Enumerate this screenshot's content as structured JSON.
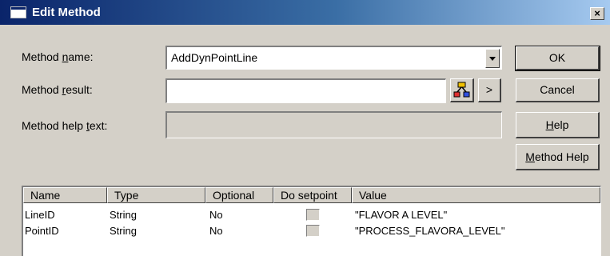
{
  "window": {
    "title": "Edit Method",
    "close_label": "×"
  },
  "form": {
    "method_name_label": "Method name:",
    "method_name_value": "AddDynPointLine",
    "method_result_label": "Method result:",
    "method_result_value": "",
    "method_help_label": "Method help text:",
    "method_help_value": ""
  },
  "buttons": {
    "ok": "OK",
    "cancel": "Cancel",
    "help": "Help",
    "method_help": "Method Help",
    "arrow": ">"
  },
  "params": {
    "columns": [
      "Name",
      "Type",
      "Optional",
      "Do setpoint",
      "Value"
    ],
    "rows": [
      {
        "name": "LineID",
        "type": "String",
        "optional": "No",
        "do_setpoint": false,
        "value": "\"FLAVOR A LEVEL\""
      },
      {
        "name": "PointID",
        "type": "String",
        "optional": "No",
        "do_setpoint": false,
        "value": "\"PROCESS_FLAVORA_LEVEL\""
      }
    ]
  }
}
